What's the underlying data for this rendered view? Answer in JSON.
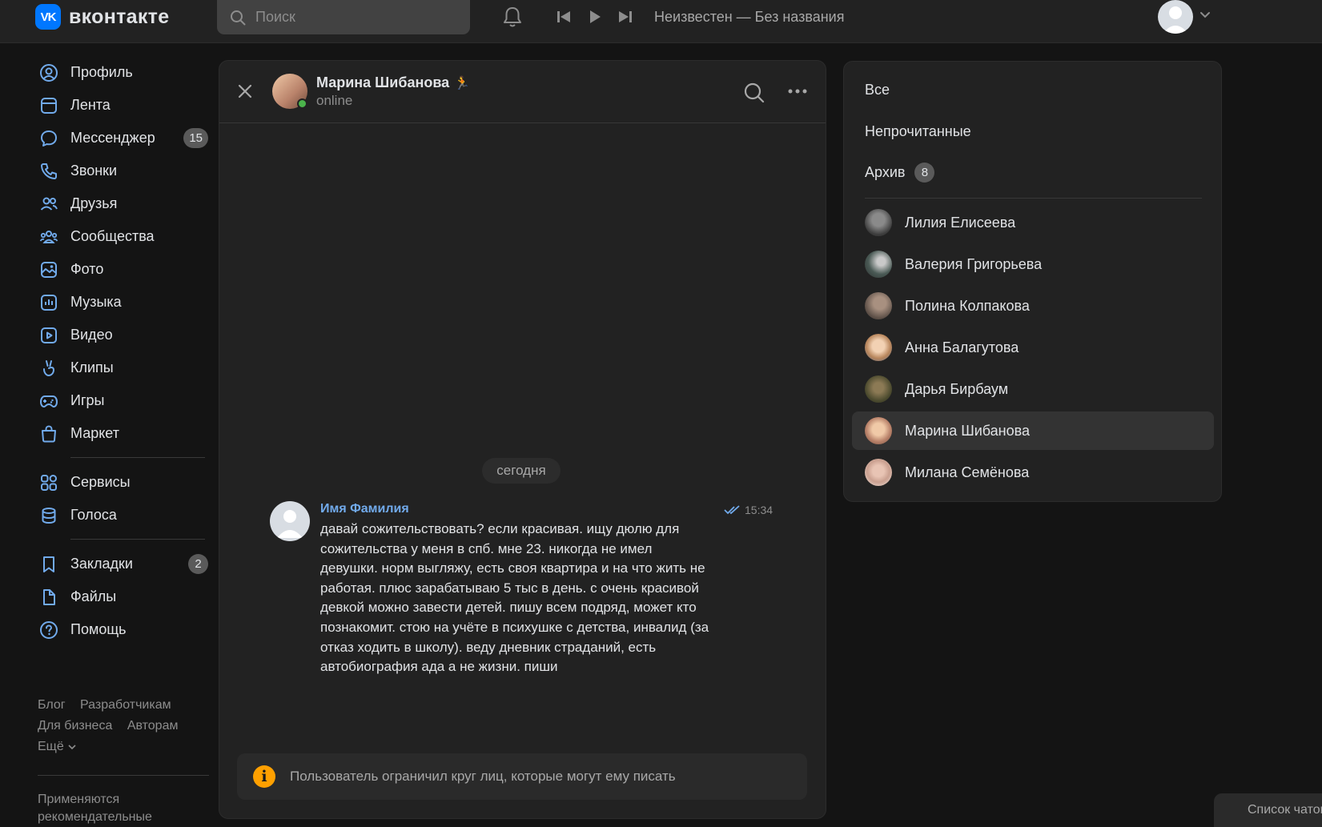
{
  "brand": {
    "logo_mark": "VK",
    "name": "вконтакте"
  },
  "search": {
    "placeholder": "Поиск"
  },
  "player": {
    "track": "Неизвестен — Без названия"
  },
  "sidebar": {
    "items": [
      {
        "label": "Профиль",
        "icon": "user-circle-icon"
      },
      {
        "label": "Лента",
        "icon": "newsfeed-icon"
      },
      {
        "label": "Мессенджер",
        "icon": "message-icon",
        "badge": "15"
      },
      {
        "label": "Звонки",
        "icon": "phone-icon"
      },
      {
        "label": "Друзья",
        "icon": "friends-icon"
      },
      {
        "label": "Сообщества",
        "icon": "communities-icon"
      },
      {
        "label": "Фото",
        "icon": "photo-icon"
      },
      {
        "label": "Музыка",
        "icon": "music-icon"
      },
      {
        "label": "Видео",
        "icon": "video-icon"
      },
      {
        "label": "Клипы",
        "icon": "clips-icon"
      },
      {
        "label": "Игры",
        "icon": "gamepad-icon"
      },
      {
        "label": "Маркет",
        "icon": "market-bag-icon"
      }
    ],
    "items2": [
      {
        "label": "Сервисы",
        "icon": "services-grid-icon"
      },
      {
        "label": "Голоса",
        "icon": "coins-icon"
      }
    ],
    "items3": [
      {
        "label": "Закладки",
        "icon": "bookmark-icon",
        "badge": "2"
      },
      {
        "label": "Файлы",
        "icon": "file-icon"
      },
      {
        "label": "Помощь",
        "icon": "help-icon"
      }
    ],
    "footer": {
      "blog": "Блог",
      "developers": "Разработчикам",
      "business": "Для бизнеса",
      "authors": "Авторам",
      "more": "Ещё",
      "note": "Применяются рекомендательные"
    }
  },
  "chat": {
    "name": "Марина Шибанова",
    "name_emoji": "🏃",
    "status": "online",
    "date_divider": "сегодня",
    "message": {
      "author": "Имя Фамилия",
      "time": "15:34",
      "text": "давай сожительствовать? если красивая. ищу дюлю для сожительства у меня в спб. мне 23. никогда не имел девушки. норм выгляжу, есть своя квартира и на что жить не работая. плюс зарабатываю 5 тыс в день. с очень красивой девкой можно завести детей. пишу всем подряд, может кто познакомит. стою на учёте в психушке с детства, инвалид (за отказ ходить в школу). веду дневник страданий, есть автобиография ада а не жизни. пиши"
    },
    "restriction_notice": "Пользователь ограничил круг лиц, которые могут ему писать"
  },
  "conversations": {
    "filters": {
      "all": "Все",
      "unread": "Непрочитанные",
      "archive": "Архив",
      "archive_count": "8"
    },
    "list": [
      {
        "name": "Лилия Елисеева",
        "active": false
      },
      {
        "name": "Валерия Григорьева",
        "active": false
      },
      {
        "name": "Полина Колпакова",
        "active": false
      },
      {
        "name": "Анна Балагутова",
        "active": false
      },
      {
        "name": "Дарья Бирбаум",
        "active": false
      },
      {
        "name": "Марина Шибанова",
        "active": true
      },
      {
        "name": "Милана Семёнова",
        "active": false
      }
    ]
  },
  "chat_list_button": {
    "label": "Список чатов"
  },
  "colors": {
    "accent": "#0077ff",
    "link": "#71aaeb",
    "online": "#4bb34b",
    "warning": "#ffa000",
    "background": "#141414",
    "panel": "#222222"
  }
}
